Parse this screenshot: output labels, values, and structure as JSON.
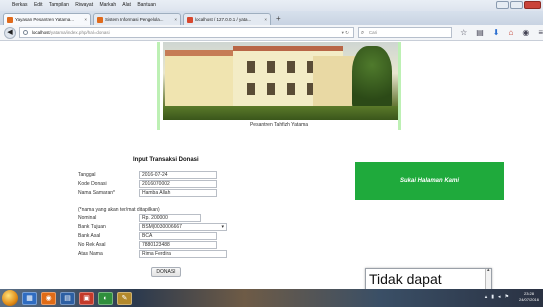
{
  "browser": {
    "menu": [
      "Berkas",
      "Edit",
      "Tampilan",
      "Riwayat",
      "Markah",
      "Alat",
      "Bantuan"
    ],
    "tabs": [
      {
        "title": "Yayasan Pesantren Yatama...",
        "active": true
      },
      {
        "title": "Sistem Informasi Pengelola...",
        "active": false
      },
      {
        "title": "localhost / 127.0.0.1 / yata...",
        "active": false
      }
    ],
    "new_tab": "+",
    "url_host": "localhost",
    "url_rest": "/yatama/index.php/hal=donasi",
    "search_placeholder": "Cari"
  },
  "hero": {
    "caption": "Pesantren Tahfizh Yatama"
  },
  "form": {
    "title": "Input Transaksi Donasi",
    "fields": [
      {
        "label": "Tanggal",
        "value": "2016-07-24"
      },
      {
        "label": "Kode Donasi",
        "value": "2016070002"
      },
      {
        "label": "Nama Samaran*",
        "value": "Hamba Allah"
      },
      {
        "label": "Nominal",
        "value": "Rp.  200000"
      },
      {
        "label": "Bank Tujuan",
        "value": "BSM|0030006667"
      },
      {
        "label": "Bank Asal",
        "value": "BCA"
      },
      {
        "label": "No Rek Asal",
        "value": "7880123488"
      },
      {
        "label": "Atas Nama",
        "value": "Rima Ferdira"
      }
    ],
    "note": "(*nama yang akan ter/mat ditapilkan)",
    "submit_label": "DONASI"
  },
  "like_box": {
    "label": "Sukai Halaman Kami"
  },
  "popup": {
    "text": "Tidak dapat"
  },
  "taskbar": {
    "clock_time": "23:28",
    "clock_date": "24/07/2016"
  },
  "colors": {
    "like_green": "#1faa3c",
    "frame_green": "#bdf0b4"
  }
}
